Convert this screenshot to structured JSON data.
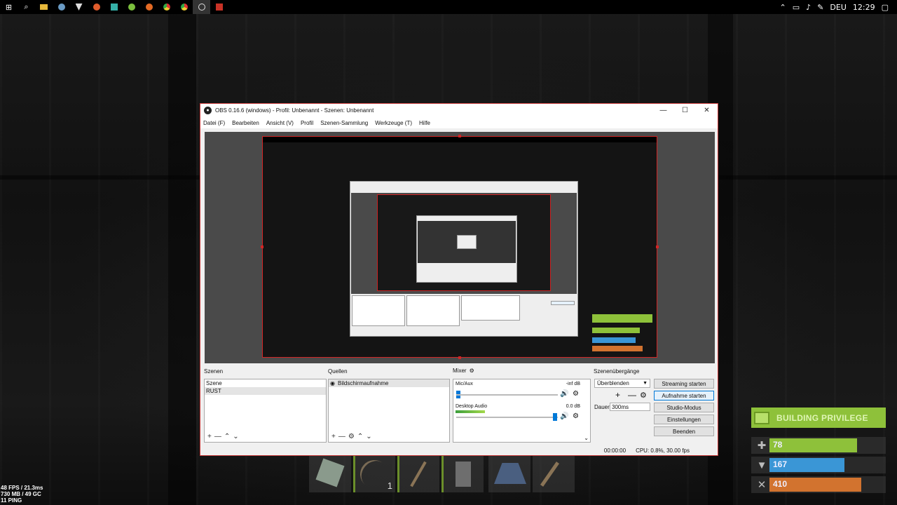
{
  "taskbar": {
    "icons": [
      "windows-start-icon",
      "search-icon",
      "file-explorer-icon",
      "steam-icon",
      "app-icon",
      "app-icon",
      "app-icon",
      "app-icon",
      "browser-icon",
      "chrome-icon",
      "chrome-icon",
      "obs-icon",
      "rust-icon"
    ],
    "language": "DEU",
    "time": "12:29"
  },
  "obs_window": {
    "title": "OBS 0.16.6 (windows) - Profil: Unbenannt - Szenen: Unbenannt",
    "controls": {
      "minimize": "—",
      "maximize": "☐",
      "close": "✕"
    },
    "menu": [
      "Datei (F)",
      "Bearbeiten",
      "Ansicht (V)",
      "Profil",
      "Szenen-Sammlung",
      "Werkzeuge (T)",
      "Hilfe"
    ],
    "scenes": {
      "title": "Szenen",
      "items": [
        "Szene",
        "RUST"
      ],
      "selected": 1
    },
    "sources": {
      "title": "Quellen",
      "items": [
        "Bildschirmaufnahme"
      ]
    },
    "mixer": {
      "title": "Mixer",
      "channels": [
        {
          "name": "Mic/Aux",
          "level": "-inf dB"
        },
        {
          "name": "Desktop Audio",
          "level": "0.0 dB"
        }
      ]
    },
    "transitions": {
      "title": "Szenenübergänge",
      "selected": "Überblenden",
      "duration_label": "Dauer",
      "duration_value": "300ms"
    },
    "controls_panel": [
      "Streaming starten",
      "Aufnahme starten",
      "Studio-Modus",
      "Einstellungen",
      "Beenden"
    ],
    "status": {
      "time": "00:00:00",
      "cpu": "CPU: 0.8%, 30.00 fps"
    }
  },
  "hud": {
    "privilege_label": "BUILDING PRIVILEGE",
    "stats": [
      {
        "icon": "health-plus-icon",
        "value": "78",
        "color": "#8ec13a",
        "fill": 0.78
      },
      {
        "icon": "water-cup-icon",
        "value": "167",
        "color": "#3a96d6",
        "fill": 0.67
      },
      {
        "icon": "food-utensils-icon",
        "value": "410",
        "color": "#d2732f",
        "fill": 0.82
      }
    ],
    "hotbar": [
      {
        "icon": "map-item-icon",
        "count": ""
      },
      {
        "icon": "bow-icon",
        "count": "1"
      },
      {
        "icon": "hatchet-icon",
        "count": ""
      },
      {
        "icon": "door-icon",
        "count": ""
      },
      {
        "icon": "helmet-icon",
        "count": ""
      },
      {
        "icon": "hammer-icon",
        "count": ""
      }
    ],
    "perf": [
      "48 FPS / 21.3ms",
      "730 MB / 49 GC",
      "11 PING"
    ]
  }
}
